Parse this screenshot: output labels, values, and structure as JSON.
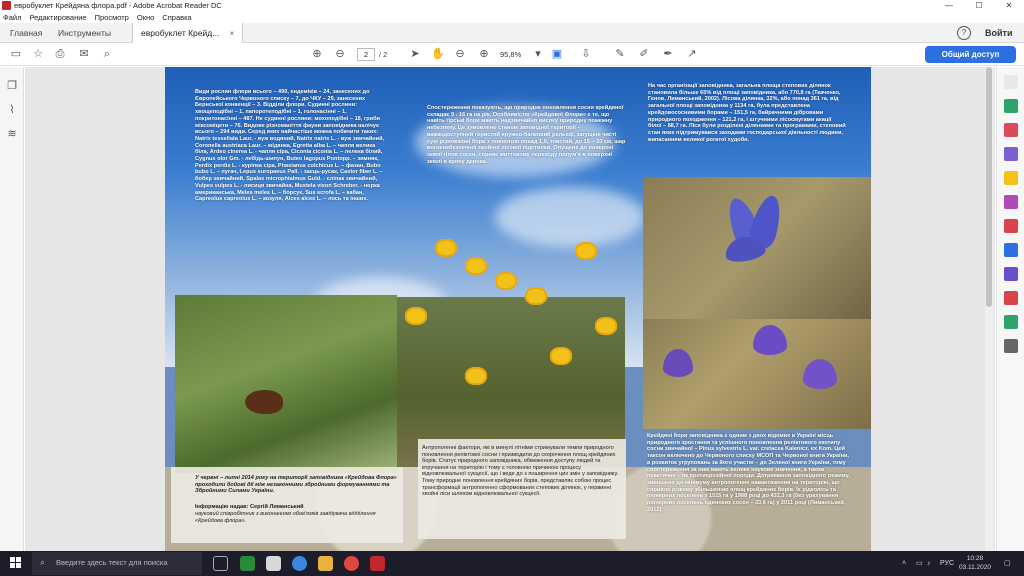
{
  "window": {
    "title": "евробуклет Крейдяна флора.pdf - Adobe Acrobat Reader DC",
    "minimize": "—",
    "maximize": "☐",
    "close": "✕"
  },
  "menu": [
    "Файл",
    "Редактирование",
    "Просмотр",
    "Окно",
    "Справка"
  ],
  "tabs": {
    "home": "Главная",
    "tools": "Инструменты",
    "document": "евробуклет Крейд...",
    "document_close": "×",
    "help": "?",
    "login": "Войти"
  },
  "toolbar": {
    "page_current": "2",
    "page_total": "/ 2",
    "zoom": "95,8%",
    "share": "Общий доступ"
  },
  "document": {
    "col1_top": "Види рослин флори всього – 490, ендеміків – 24, занесених до Європейського Червоного списку – 7, до ЧКУ – 29, занесених Бернської конвенції – 3. Відділи флори. Судинні рослини: хвощеподібні – 1, папоротеподібні – 1, голонасінні – 1, покритонасінні – 487. Не судинні рослини: мохоподібні – 18, гриби міксоміцети – 76. Видове різноманіття фауни заповідника налічує всього – 294 види. Серед яких найчастіше можна побачити таких: Natrix tessellata Laur. - вуж водяний, Natrix natrix L. - вуж звичайний, Coronella austriaca Laur. – мідянка, Egretta alba L. – чапля велика біла, Ardeo cinerea L. - чапля сіра, Ciconia ciconia L. – лелека білий, Cygnus olor Gm. - лебідь-шипун, Buteo lagopus Pontopp. – зимняк, Perdix perdix L. - куріпка сіра, Phasianus colchicus L. – фазан, Bubo bubo L. – пугач, Lepus europaeus Pall. - заєць-русак, Castor fiber L. – бобер звичайний, Spalax microphtalmus Guld. - сліпак звичайний, Vulpes vulpes L. - лисиця звичайна, Mustela vison Schreber. - норка американська, Meles meles L. – борсук, Sus scrofa L. – кабан, Capreolus capreolus L. – козуля, Alces alces L. – лось та інших.",
    "col2_top": "Спостереження показують, що природне поновлення сосни крейдяної складає 9 - 16 га на рік. Особливістю «Крейдової Флори» є те, що навіть гірські бори мають надзвичайно високу природну пожежну небезпеку. Це зумовлено станом заповідної території – важкодоступний гористий яружно-балковий рельєф, загущені чисті сухі різновікові бори з повнотою понад 1,0, товстий, до 15 – 20 см, шар вогненебезпечної хвойної лісової підстилки. Опущене до поверхні землі гілля сосен, сприяє миттєвому переходу полум'я в поверхні землі в крону дерева.",
    "col3_top": "На час організації заповідника, загальна площа степових ділянок становила більше 65% від площі заповідника, або 770,8 га (Ткаченко, Генов, Лиманський, 2002). Лісова ділянка, 32%, або понад 361 га, від загальної площі заповідника у 1134 га, була представлена крейдовососнивими борами – 151,5 га, байрачними дібровами природного походження – 121,2 га, і штучними лісосмугами акації білої – 88,7 га. Ліси були розділені ділянками та програмами, степовий стан яких підтримувався заходами господарської діяльності людини, випасанням великої рогатої худоби.",
    "caption_left": "У червні – липні 2014 року на території заповідника «Крейдова Флора» проходили бойові дії між незаконними збройними формуваннями та Збройними Силами України.",
    "info_label": "Інформацію надав: Сергій Лиманський",
    "info_role": "науковий співробітник з виконанням обов'язків завідувача відділення «Крейдова флора».",
    "caption_mid": "Антропогенні фактори, які в минулі літніми стримували темпи природного поновлення реліктової сосни і призводили до скорочення площ крейдяних борів. Статус природного заповідника, обмеження доступу людей та втручання на територію і тому є головною причиною процесу відновлювальної сукцесії, що і веде до з поширення цих змін у заповіднику. Тому природне поновлення крейдяних борів, представляє собою процес трансформації антропогенно сформованих степових ділянок, у первинні хвойні ліси шляхом відновлювальної сукцесії.",
    "caption_right": "Крейдяні бори заповідника є одним з двох відомих в Україні місць природного зростання та успішного поновлення реліктового екотипу сосни звичайної – Pinus sylvestris L. var. cretacea Kalenicz. ex Kom. Цей таксон включено до Червоного списку МСОП та Червоної книги України, а розвиток угруповань за його участю – до Зеленої книги України, тому спостереження за ним мають велике наукове значення, а також практичне – як протиерозійної породи. Дотримання заповідного режиму, зменшено до мінімуму антропогенне навантаження на територію, що сприяло різкому збільшенню площ крейдяних борів. Їх рідколісь та піонерних поселень з 1515 га у 1988 році до 432,3 га (без урахування піонерних поселень одиноких сосен – 33,6 га) у 2011 році (Лиманський, 2012)."
  },
  "taskbar": {
    "search_placeholder": "Введите здесь текст для поиска",
    "lang": "РУС",
    "time": "10:28",
    "date": "03.11.2020"
  },
  "colors": {
    "accent": "#2b6fe0",
    "taskbar": "#1c1c2a",
    "acrobat_red": "#c0282d"
  }
}
